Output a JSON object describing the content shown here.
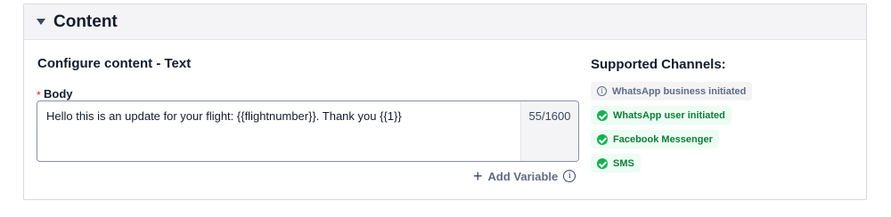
{
  "panel": {
    "title": "Content"
  },
  "configure": {
    "title": "Configure content - Text",
    "required_mark": "*",
    "body_label": "Body",
    "body_value": "Hello this is an update for your flight: {{flightnumber}}. Thank you {{1}}",
    "char_count": "55/1600",
    "add_variable_label": "Add Variable",
    "add_variable_icon": "plus-icon"
  },
  "channels": {
    "title": "Supported Channels:",
    "items": [
      {
        "label": "WhatsApp business initiated",
        "status": "info",
        "icon": "info-icon"
      },
      {
        "label": "WhatsApp user initiated",
        "status": "supported",
        "icon": "check-circle-icon"
      },
      {
        "label": "Facebook Messenger",
        "status": "supported",
        "icon": "check-circle-icon"
      },
      {
        "label": "SMS",
        "status": "supported",
        "icon": "check-circle-icon"
      }
    ]
  },
  "colors": {
    "success": "#14b053",
    "success_text": "#0e7c3a",
    "neutral_text": "#606b85",
    "required": "#d61f1f"
  }
}
